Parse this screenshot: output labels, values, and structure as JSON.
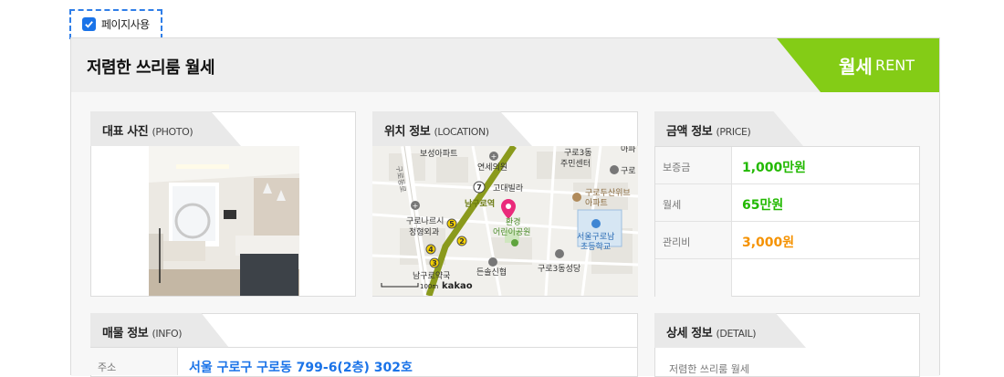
{
  "page_use": {
    "label": "페이지사용",
    "checked": true
  },
  "listing": {
    "title": "저렴한 쓰리룸 월세",
    "type_main": "월세",
    "type_sub": "RENT",
    "tag_color": "#84cc16"
  },
  "sections": {
    "photo": {
      "title": "대표 사진",
      "sub": "(PHOTO)"
    },
    "location": {
      "title": "위치 정보",
      "sub": "(LOCATION)"
    },
    "price": {
      "title": "금액 정보",
      "sub": "(PRICE)"
    },
    "info": {
      "title": "매물 정보",
      "sub": "(INFO)"
    },
    "detail": {
      "title": "상세 정보",
      "sub": "(DETAIL)"
    }
  },
  "price": {
    "rows": [
      {
        "label": "보증금",
        "value": "1,000만원",
        "color": "#22b900"
      },
      {
        "label": "월세",
        "value": "65만원",
        "color": "#22b900"
      },
      {
        "label": "관리비",
        "value": "3,000원",
        "color": "#f59200"
      }
    ]
  },
  "info": {
    "address_label": "주소",
    "address_value": "서울 구로구 구로동 799-6(2층) 302호"
  },
  "detail": {
    "text": "저렴한 쓰리룸 월세"
  },
  "map": {
    "labels": {
      "apt1": "보성아파트",
      "hosp": "연세의원",
      "villa": "고대빌라",
      "dong1": "구로3동",
      "center": "주민센터",
      "apt2": "구로두산위브",
      "apt2b": "아파트",
      "park": "환경",
      "park2": "어린이공원",
      "school1": "서울구로남",
      "school2": "초등학교",
      "narae": "구로나르시",
      "clinic": "정형외과",
      "pharm": "남구로약국",
      "mart": "든솔신협",
      "church": "구로3동성당",
      "station": "남구로역",
      "road": "구로동로",
      "scale": "100m",
      "brand": "kakao",
      "partial1": "아파",
      "partial2": "구로"
    }
  }
}
